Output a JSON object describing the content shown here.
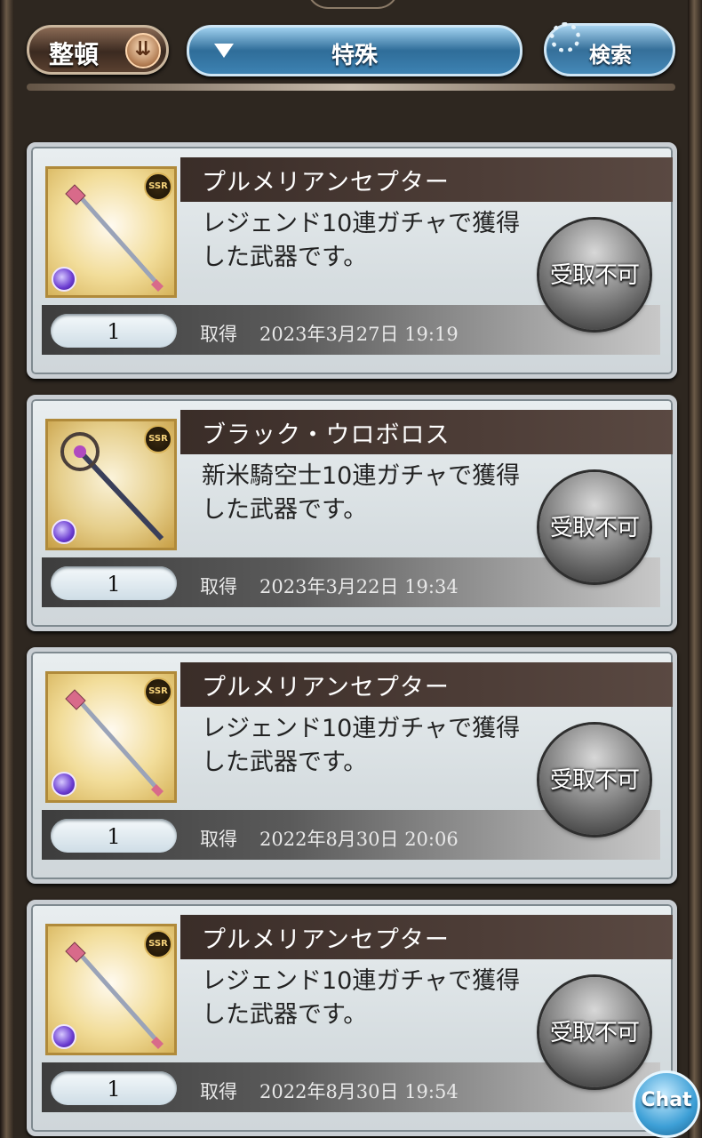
{
  "toolbar": {
    "sort_label": "整頓",
    "filter_label": "特殊",
    "search_label": "検索"
  },
  "items": [
    {
      "name": "プルメリアンセプター",
      "description": "レジェンド10連ガチャで獲得した武器です。",
      "count": "1",
      "acquired_label": "取得",
      "acquired_date": "2023年3月27日 19:19",
      "status": "受取不可",
      "rarity": "SSR",
      "weapon_icon": "scepter-icon"
    },
    {
      "name": "ブラック・ウロボロス",
      "description": "新米騎空士10連ガチャで獲得した武器です。",
      "count": "1",
      "acquired_label": "取得",
      "acquired_date": "2023年3月22日 19:34",
      "status": "受取不可",
      "rarity": "SSR",
      "weapon_icon": "staff-icon"
    },
    {
      "name": "プルメリアンセプター",
      "description": "レジェンド10連ガチャで獲得した武器です。",
      "count": "1",
      "acquired_label": "取得",
      "acquired_date": "2022年8月30日 20:06",
      "status": "受取不可",
      "rarity": "SSR",
      "weapon_icon": "scepter-icon"
    },
    {
      "name": "プルメリアンセプター",
      "description": "レジェンド10連ガチャで獲得した武器です。",
      "count": "1",
      "acquired_label": "取得",
      "acquired_date": "2022年8月30日 19:54",
      "status": "受取不可",
      "rarity": "SSR",
      "weapon_icon": "scepter-icon"
    }
  ],
  "chat_label": "Chat"
}
